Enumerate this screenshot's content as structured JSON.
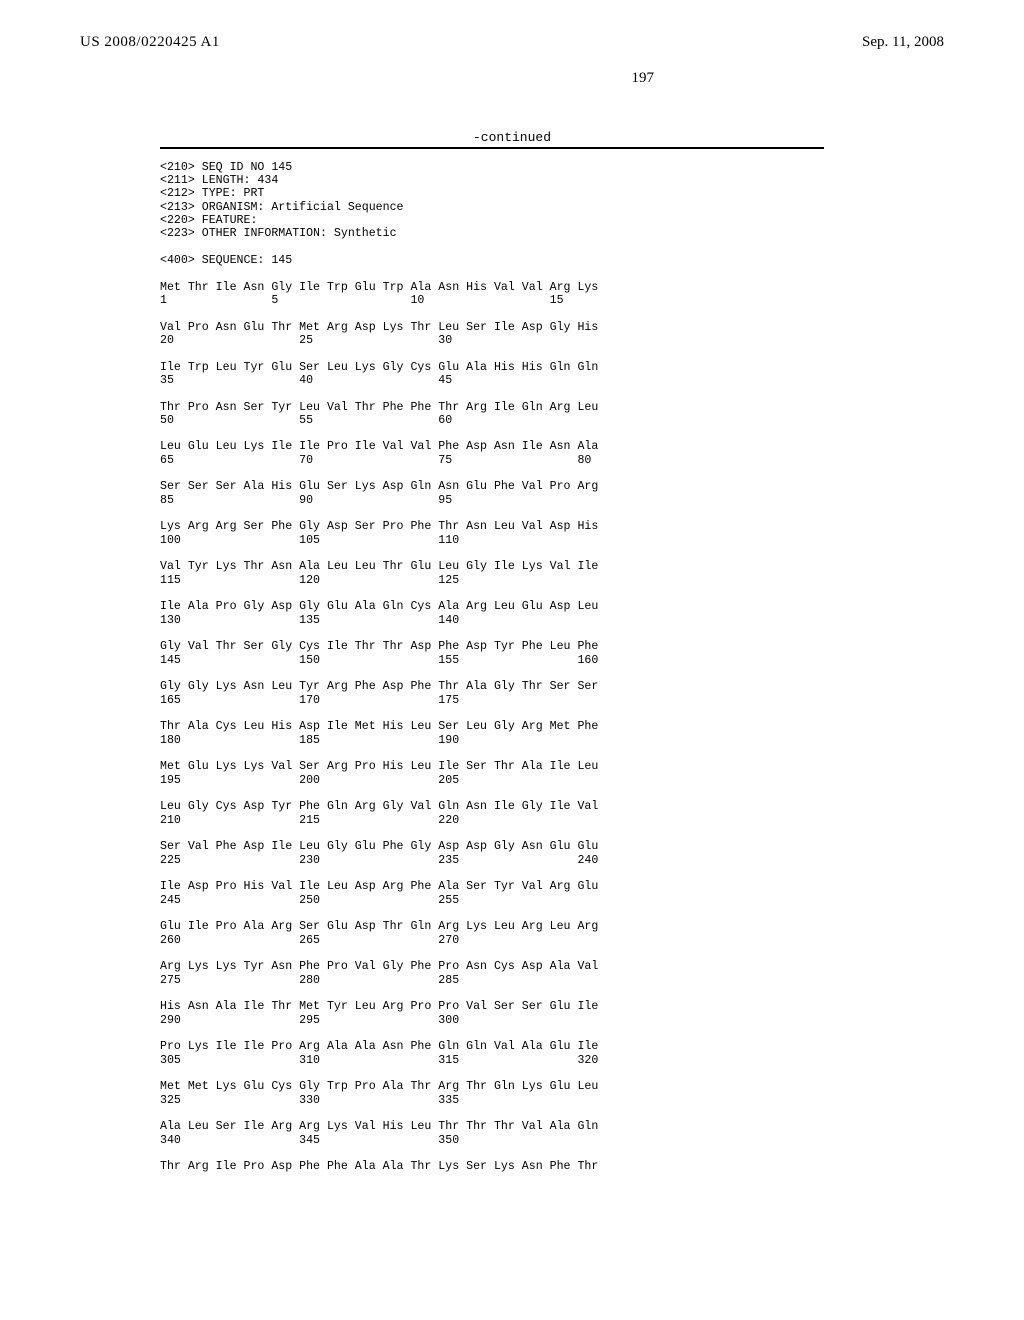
{
  "header": {
    "pub_no": "US 2008/0220425 A1",
    "date": "Sep. 11, 2008",
    "page": "197"
  },
  "continued_label": "-continued",
  "seq_header": [
    "<210> SEQ ID NO 145",
    "<211> LENGTH: 434",
    "<212> TYPE: PRT",
    "<213> ORGANISM: Artificial Sequence",
    "<220> FEATURE:",
    "<223> OTHER INFORMATION: Synthetic",
    "",
    "<400> SEQUENCE: 145"
  ],
  "sequence_rows": [
    {
      "aa": "Met Thr Ile Asn Gly Ile Trp Glu Trp Ala Asn His Val Val Arg Lys",
      "nums": "1               5                   10                  15"
    },
    {
      "aa": "Val Pro Asn Glu Thr Met Arg Asp Lys Thr Leu Ser Ile Asp Gly His",
      "nums": "20                  25                  30"
    },
    {
      "aa": "Ile Trp Leu Tyr Glu Ser Leu Lys Gly Cys Glu Ala His His Gln Gln",
      "nums": "35                  40                  45"
    },
    {
      "aa": "Thr Pro Asn Ser Tyr Leu Val Thr Phe Phe Thr Arg Ile Gln Arg Leu",
      "nums": "50                  55                  60"
    },
    {
      "aa": "Leu Glu Leu Lys Ile Ile Pro Ile Val Val Phe Asp Asn Ile Asn Ala",
      "nums": "65                  70                  75                  80"
    },
    {
      "aa": "Ser Ser Ser Ala His Glu Ser Lys Asp Gln Asn Glu Phe Val Pro Arg",
      "nums": "85                  90                  95"
    },
    {
      "aa": "Lys Arg Arg Ser Phe Gly Asp Ser Pro Phe Thr Asn Leu Val Asp His",
      "nums": "100                 105                 110"
    },
    {
      "aa": "Val Tyr Lys Thr Asn Ala Leu Leu Thr Glu Leu Gly Ile Lys Val Ile",
      "nums": "115                 120                 125"
    },
    {
      "aa": "Ile Ala Pro Gly Asp Gly Glu Ala Gln Cys Ala Arg Leu Glu Asp Leu",
      "nums": "130                 135                 140"
    },
    {
      "aa": "Gly Val Thr Ser Gly Cys Ile Thr Thr Asp Phe Asp Tyr Phe Leu Phe",
      "nums": "145                 150                 155                 160"
    },
    {
      "aa": "Gly Gly Lys Asn Leu Tyr Arg Phe Asp Phe Thr Ala Gly Thr Ser Ser",
      "nums": "165                 170                 175"
    },
    {
      "aa": "Thr Ala Cys Leu His Asp Ile Met His Leu Ser Leu Gly Arg Met Phe",
      "nums": "180                 185                 190"
    },
    {
      "aa": "Met Glu Lys Lys Val Ser Arg Pro His Leu Ile Ser Thr Ala Ile Leu",
      "nums": "195                 200                 205"
    },
    {
      "aa": "Leu Gly Cys Asp Tyr Phe Gln Arg Gly Val Gln Asn Ile Gly Ile Val",
      "nums": "210                 215                 220"
    },
    {
      "aa": "Ser Val Phe Asp Ile Leu Gly Glu Phe Gly Asp Asp Gly Asn Glu Glu",
      "nums": "225                 230                 235                 240"
    },
    {
      "aa": "Ile Asp Pro His Val Ile Leu Asp Arg Phe Ala Ser Tyr Val Arg Glu",
      "nums": "245                 250                 255"
    },
    {
      "aa": "Glu Ile Pro Ala Arg Ser Glu Asp Thr Gln Arg Lys Leu Arg Leu Arg",
      "nums": "260                 265                 270"
    },
    {
      "aa": "Arg Lys Lys Tyr Asn Phe Pro Val Gly Phe Pro Asn Cys Asp Ala Val",
      "nums": "275                 280                 285"
    },
    {
      "aa": "His Asn Ala Ile Thr Met Tyr Leu Arg Pro Pro Val Ser Ser Glu Ile",
      "nums": "290                 295                 300"
    },
    {
      "aa": "Pro Lys Ile Ile Pro Arg Ala Ala Asn Phe Gln Gln Val Ala Glu Ile",
      "nums": "305                 310                 315                 320"
    },
    {
      "aa": "Met Met Lys Glu Cys Gly Trp Pro Ala Thr Arg Thr Gln Lys Glu Leu",
      "nums": "325                 330                 335"
    },
    {
      "aa": "Ala Leu Ser Ile Arg Arg Lys Val His Leu Thr Thr Thr Val Ala Gln",
      "nums": "340                 345                 350"
    },
    {
      "aa": "Thr Arg Ile Pro Asp Phe Phe Ala Ala Thr Lys Ser Lys Asn Phe Thr",
      "nums": ""
    }
  ]
}
